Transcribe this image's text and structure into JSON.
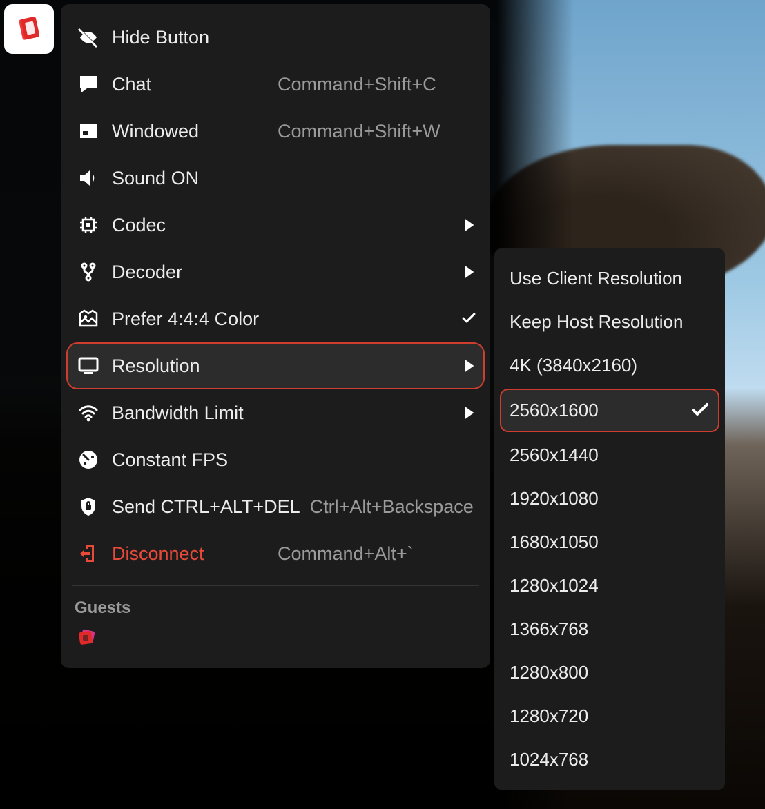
{
  "menu": {
    "items": [
      {
        "id": "hide-button",
        "label": "Hide Button",
        "shortcut": "",
        "tail": "none"
      },
      {
        "id": "chat",
        "label": "Chat",
        "shortcut": "Command+Shift+C",
        "tail": "none"
      },
      {
        "id": "windowed",
        "label": "Windowed",
        "shortcut": "Command+Shift+W",
        "tail": "none"
      },
      {
        "id": "sound",
        "label": "Sound ON",
        "shortcut": "",
        "tail": "none"
      },
      {
        "id": "codec",
        "label": "Codec",
        "shortcut": "",
        "tail": "submenu"
      },
      {
        "id": "decoder",
        "label": "Decoder",
        "shortcut": "",
        "tail": "submenu"
      },
      {
        "id": "prefer-444",
        "label": "Prefer 4:4:4 Color",
        "shortcut": "",
        "tail": "check"
      },
      {
        "id": "resolution",
        "label": "Resolution",
        "shortcut": "",
        "tail": "submenu"
      },
      {
        "id": "bandwidth",
        "label": "Bandwidth Limit",
        "shortcut": "",
        "tail": "submenu"
      },
      {
        "id": "constant-fps",
        "label": "Constant FPS",
        "shortcut": "",
        "tail": "none"
      },
      {
        "id": "send-cad",
        "label": "Send CTRL+ALT+DEL",
        "shortcut": "Ctrl+Alt+Backspace",
        "tail": "none"
      },
      {
        "id": "disconnect",
        "label": "Disconnect",
        "shortcut": "Command+Alt+`",
        "tail": "none"
      }
    ],
    "active_id": "resolution",
    "danger_id": "disconnect",
    "guests_header": "Guests"
  },
  "submenu": {
    "items": [
      {
        "label": "Use Client Resolution"
      },
      {
        "label": "Keep Host Resolution"
      },
      {
        "label": "4K (3840x2160)"
      },
      {
        "label": "2560x1600"
      },
      {
        "label": "2560x1440"
      },
      {
        "label": "1920x1080"
      },
      {
        "label": "1680x1050"
      },
      {
        "label": "1280x1024"
      },
      {
        "label": "1366x768"
      },
      {
        "label": "1280x800"
      },
      {
        "label": "1280x720"
      },
      {
        "label": "1024x768"
      }
    ],
    "selected_index": 3
  }
}
